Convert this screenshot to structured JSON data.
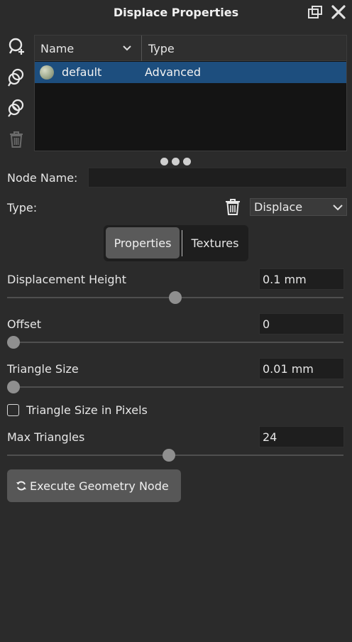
{
  "window": {
    "title": "Displace Properties"
  },
  "list": {
    "columns": [
      "Name",
      "Type"
    ],
    "rows": [
      {
        "name": "default",
        "type": "Advanced"
      }
    ]
  },
  "node": {
    "name_label": "Node Name:",
    "name_value": "",
    "type_label": "Type:",
    "type_value": "Displace"
  },
  "tabs": {
    "properties": "Properties",
    "textures": "Textures"
  },
  "params": {
    "displacement_height": {
      "label": "Displacement Height",
      "value": "0.1 mm",
      "slider_fraction": 0.5
    },
    "offset": {
      "label": "Offset",
      "value": "0",
      "slider_fraction": 0.0
    },
    "triangle_size": {
      "label": "Triangle Size",
      "value": "0.01 mm",
      "slider_fraction": 0.0
    },
    "triangle_size_in_pixels": {
      "label": "Triangle Size in Pixels",
      "checked": false
    },
    "max_triangles": {
      "label": "Max Triangles",
      "value": "24",
      "slider_fraction": 0.48
    }
  },
  "actions": {
    "execute": "Execute Geometry Node"
  },
  "colors": {
    "panel_bg": "#2b2b2b",
    "selection": "#1d4e7e",
    "field_bg": "#1e1e1e",
    "button_bg": "#575757"
  }
}
